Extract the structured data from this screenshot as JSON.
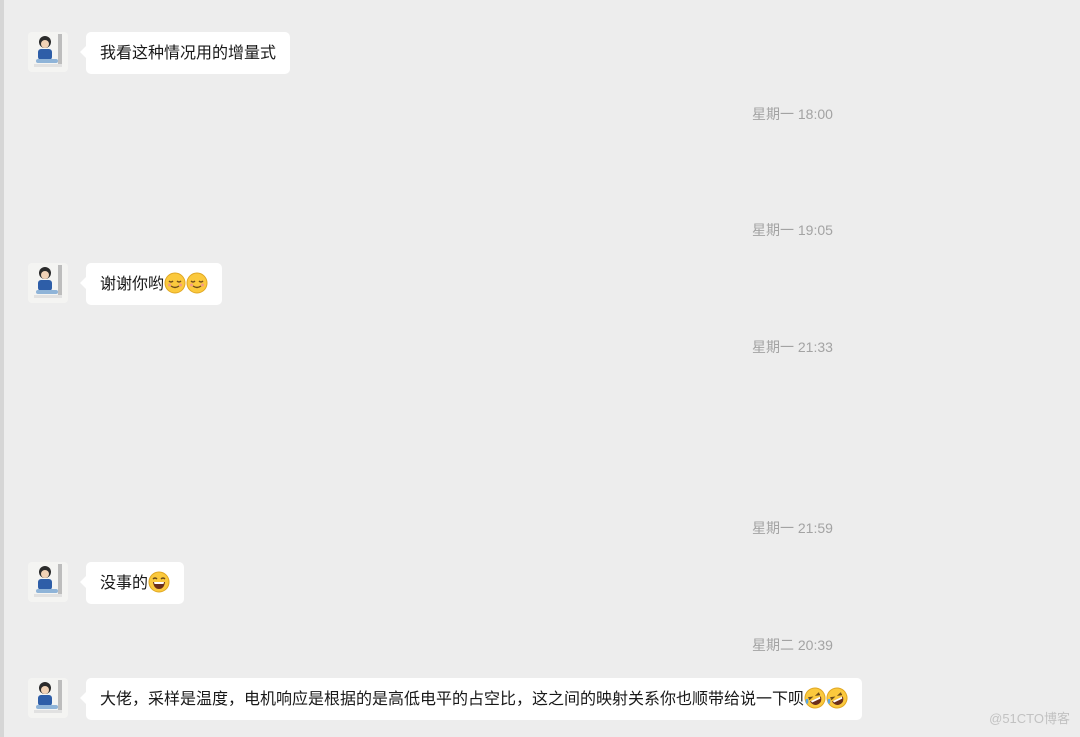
{
  "messages": [
    {
      "text": "我看这种情况用的增量式",
      "emojis": []
    },
    {
      "text": "谢谢你哟",
      "emojis": [
        "relieved-face",
        "relieved-face"
      ]
    },
    {
      "text": "没事的",
      "emojis": [
        "grinning-face"
      ]
    },
    {
      "text": "大佬，采样是温度，电机响应是根据的是高低电平的占空比，这之间的映射关系你也顺带给说一下呗",
      "emojis": [
        "rolling-laughing-face",
        "rolling-laughing-face"
      ]
    }
  ],
  "timestamps": [
    "星期一 18:00",
    "星期一 19:05",
    "星期一 21:33",
    "星期一 21:59",
    "星期二 20:39"
  ],
  "watermark": "@51CTO博客",
  "colors": {
    "background": "#ededed",
    "bubble": "#ffffff",
    "timestamp_text": "#a3a3a3",
    "message_text": "#181818",
    "emoji_yellow": "#fbc93d"
  }
}
